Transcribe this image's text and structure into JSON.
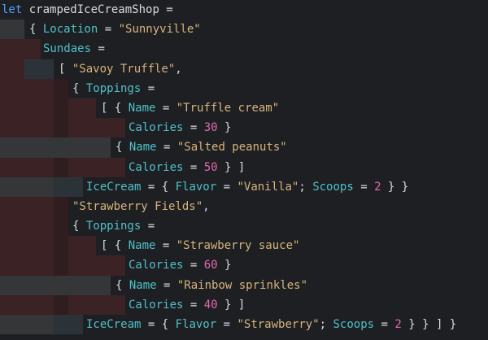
{
  "colors": {
    "background": "#1e1f22",
    "keyword": "#4ea1ff",
    "identifier": "#d7dae0",
    "field": "#4fc1c9",
    "string": "#d6b47c",
    "number": "#e06bb1",
    "indent_guide_red": "#3a2225",
    "indent_guide_dark_red": "#2f1d20",
    "indent_guide_gray": "#343638",
    "indent_guide_slate": "#2c3338"
  },
  "code": {
    "lines": [
      {
        "tokens": [
          [
            "kw",
            "let"
          ],
          [
            "plain",
            " crampedIceCreamShop ="
          ]
        ]
      },
      {
        "tokens": [
          [
            "plain",
            "{ "
          ],
          [
            "field",
            "Location"
          ],
          [
            "plain",
            " = "
          ],
          [
            "str",
            "\"Sunnyville\""
          ]
        ]
      },
      {
        "tokens": [
          [
            "field",
            "Sundaes"
          ],
          [
            "plain",
            " ="
          ]
        ]
      },
      {
        "tokens": [
          [
            "plain",
            "[ "
          ],
          [
            "str",
            "\"Savoy Truffle\""
          ],
          [
            "plain",
            ","
          ]
        ]
      },
      {
        "tokens": [
          [
            "plain",
            "{ "
          ],
          [
            "field",
            "Toppings"
          ],
          [
            "plain",
            " ="
          ]
        ]
      },
      {
        "tokens": [
          [
            "plain",
            "[ { "
          ],
          [
            "field",
            "Name"
          ],
          [
            "plain",
            " = "
          ],
          [
            "str",
            "\"Truffle cream\""
          ]
        ]
      },
      {
        "tokens": [
          [
            "field",
            "Calories"
          ],
          [
            "plain",
            " = "
          ],
          [
            "num",
            "30"
          ],
          [
            "plain",
            " }"
          ]
        ]
      },
      {
        "tokens": [
          [
            "plain",
            "{ "
          ],
          [
            "field",
            "Name"
          ],
          [
            "plain",
            " = "
          ],
          [
            "str",
            "\"Salted peanuts\""
          ]
        ]
      },
      {
        "tokens": [
          [
            "field",
            "Calories"
          ],
          [
            "plain",
            " = "
          ],
          [
            "num",
            "50"
          ],
          [
            "plain",
            " } ]"
          ]
        ]
      },
      {
        "tokens": [
          [
            "field",
            "IceCream"
          ],
          [
            "plain",
            " = { "
          ],
          [
            "field",
            "Flavor"
          ],
          [
            "plain",
            " = "
          ],
          [
            "str",
            "\"Vanilla\""
          ],
          [
            "plain",
            "; "
          ],
          [
            "field",
            "Scoops"
          ],
          [
            "plain",
            " = "
          ],
          [
            "num",
            "2"
          ],
          [
            "plain",
            " } }"
          ]
        ]
      },
      {
        "tokens": [
          [
            "str",
            "\"Strawberry Fields\""
          ],
          [
            "plain",
            ","
          ]
        ]
      },
      {
        "tokens": [
          [
            "plain",
            "{ "
          ],
          [
            "field",
            "Toppings"
          ],
          [
            "plain",
            " ="
          ]
        ]
      },
      {
        "tokens": [
          [
            "plain",
            "[ { "
          ],
          [
            "field",
            "Name"
          ],
          [
            "plain",
            " = "
          ],
          [
            "str",
            "\"Strawberry sauce\""
          ]
        ]
      },
      {
        "tokens": [
          [
            "field",
            "Calories"
          ],
          [
            "plain",
            " = "
          ],
          [
            "num",
            "60"
          ],
          [
            "plain",
            " }"
          ]
        ]
      },
      {
        "tokens": [
          [
            "plain",
            "{ "
          ],
          [
            "field",
            "Name"
          ],
          [
            "plain",
            " = "
          ],
          [
            "str",
            "\"Rainbow sprinkles\""
          ]
        ]
      },
      {
        "tokens": [
          [
            "field",
            "Calories"
          ],
          [
            "plain",
            " = "
          ],
          [
            "num",
            "40"
          ],
          [
            "plain",
            " } ]"
          ]
        ]
      },
      {
        "tokens": [
          [
            "field",
            "IceCream"
          ],
          [
            "plain",
            " = { "
          ],
          [
            "field",
            "Flavor"
          ],
          [
            "plain",
            " = "
          ],
          [
            "str",
            "\"Strawberry\""
          ],
          [
            "plain",
            "; "
          ],
          [
            "field",
            "Scoops"
          ],
          [
            "plain",
            " = "
          ],
          [
            "num",
            "2"
          ],
          [
            "plain",
            " } } ] }"
          ]
        ]
      }
    ]
  }
}
